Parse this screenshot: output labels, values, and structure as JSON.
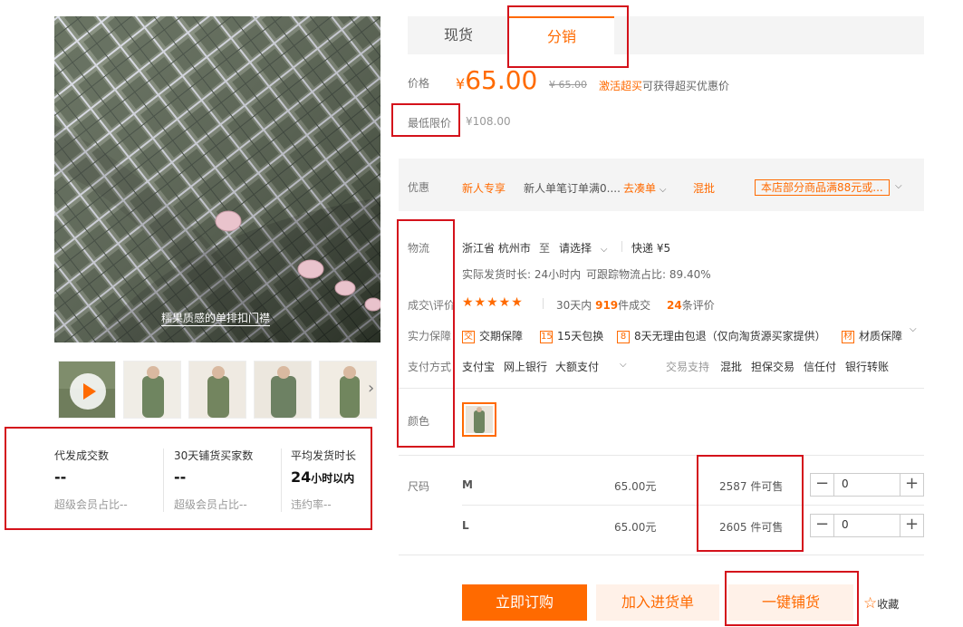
{
  "gallery": {
    "caption": "糯果质感的单排扣门襟",
    "thumbnail_count": 5
  },
  "stats": [
    {
      "label": "代发成交数",
      "value": "--",
      "sub": "超级会员占比--"
    },
    {
      "label": "30天铺货买家数",
      "value": "--",
      "sub": "超级会员占比--"
    },
    {
      "label": "平均发货时长",
      "value": "24",
      "value_unit": "小时以内",
      "sub": "违约率--"
    }
  ],
  "tabs": [
    {
      "label": "现货",
      "active": false
    },
    {
      "label": "分销",
      "active": true
    }
  ],
  "price": {
    "label": "价格",
    "currency": "¥",
    "amount": "65.00",
    "original": "¥ 65.00",
    "activate_link": "激活超买",
    "activate_text": "可获得超买优惠价"
  },
  "min_price": {
    "label": "最低限价",
    "value": "¥108.00"
  },
  "promo": {
    "label": "优惠",
    "tag1": "新人专享",
    "desc": "新人单笔订单满0....",
    "go_link": "去凑单",
    "mix": "混批",
    "tag2": "本店部分商品满88元或..."
  },
  "logistics": {
    "label": "物流",
    "from": "浙江省 杭州市",
    "to_word": "至",
    "select": "请选择",
    "express": "快递 ¥5",
    "ship_time": "实际发货时长: 24小时内",
    "trace_ratio": "可跟踪物流占比: 89.40%"
  },
  "reviews": {
    "label": "成交\\评价",
    "stars": "★★★★★",
    "deals_prefix": "30天内",
    "deals_count": "919",
    "deals_suffix": "件成交",
    "review_count": "24",
    "review_suffix": "条评价"
  },
  "guarantee": {
    "label": "实力保障",
    "items": [
      {
        "icon": "shield-icon",
        "glyph": "交",
        "text": "交期保障"
      },
      {
        "icon": "calendar-icon",
        "glyph": "15",
        "text": "15天包换"
      },
      {
        "icon": "return-icon",
        "glyph": "8",
        "text": "8天无理由包退（仅向淘货源买家提供）"
      },
      {
        "icon": "material-icon",
        "glyph": "材",
        "text": "材质保障"
      }
    ]
  },
  "payment": {
    "label": "支付方式",
    "methods": [
      "支付宝",
      "网上银行",
      "大额支付"
    ],
    "trade_label": "交易支持",
    "trade_methods": [
      "混批",
      "担保交易",
      "信任付",
      "银行转账"
    ]
  },
  "color": {
    "label": "颜色"
  },
  "sizes": {
    "label": "尺码",
    "rows": [
      {
        "size": "M",
        "price": "65.00元",
        "stock": "2587 件可售",
        "qty": "0"
      },
      {
        "size": "L",
        "price": "65.00元",
        "stock": "2605 件可售",
        "qty": "0"
      }
    ]
  },
  "actions": {
    "buy": "立即订购",
    "cart": "加入进货单",
    "distribute": "一键铺货",
    "favorite": "收藏"
  },
  "colors": {
    "accent": "#ff6a00",
    "highlight_box": "#d4121b"
  }
}
